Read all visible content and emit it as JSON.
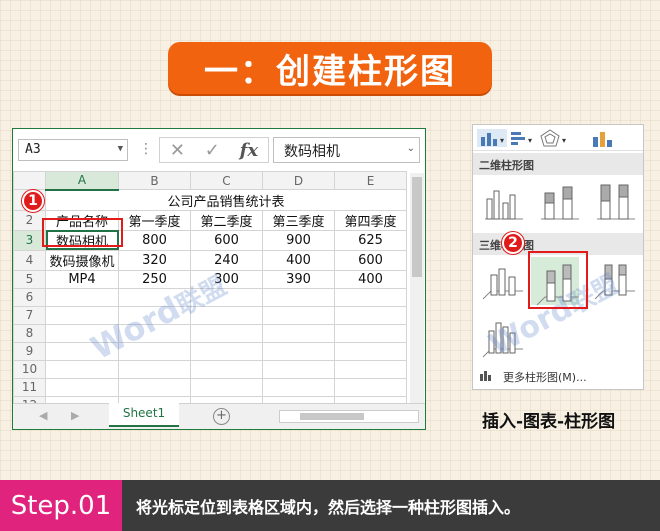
{
  "banner": {
    "title": "一：创建柱形图"
  },
  "excel": {
    "name_box": "A3",
    "formula_content": "数码相机",
    "fx_symbol": "fx",
    "column_headers": [
      "A",
      "B",
      "C",
      "D",
      "E"
    ],
    "rows": [
      {
        "num": "1",
        "cells": [
          "公司产品销售统计表"
        ]
      },
      {
        "num": "2",
        "cells": [
          "产品名称",
          "第一季度",
          "第二季度",
          "第三季度",
          "第四季度"
        ]
      },
      {
        "num": "3",
        "cells": [
          "数码相机",
          "800",
          "600",
          "900",
          "625"
        ]
      },
      {
        "num": "4",
        "cells": [
          "数码摄像机",
          "320",
          "240",
          "400",
          "600"
        ]
      },
      {
        "num": "5",
        "cells": [
          "MP4",
          "250",
          "300",
          "390",
          "400"
        ]
      },
      {
        "num": "6",
        "cells": []
      },
      {
        "num": "7",
        "cells": []
      },
      {
        "num": "8",
        "cells": []
      },
      {
        "num": "9",
        "cells": []
      },
      {
        "num": "10",
        "cells": []
      },
      {
        "num": "11",
        "cells": []
      },
      {
        "num": "12",
        "cells": []
      }
    ],
    "sheet_tab": "Sheet1",
    "add_sheet": "+"
  },
  "badges": {
    "one": "1",
    "two": "2"
  },
  "watermark": {
    "en": "Word",
    "zh": "联盟",
    "url": "www.wordlm.com"
  },
  "chart_panel": {
    "section_2d": "二维柱形图",
    "section_3d": "三维柱形图",
    "more_label": "更多柱形图(M)..."
  },
  "caption": "插入-图表-柱形图",
  "footer": {
    "step": "Step.01",
    "text": "将光标定位到表格区域内，然后选择一种柱形图插入。"
  },
  "colors": {
    "accent_orange": "#f2630f",
    "excel_green": "#217346",
    "highlight_red": "#e11a1a",
    "step_pink": "#e0237d"
  }
}
